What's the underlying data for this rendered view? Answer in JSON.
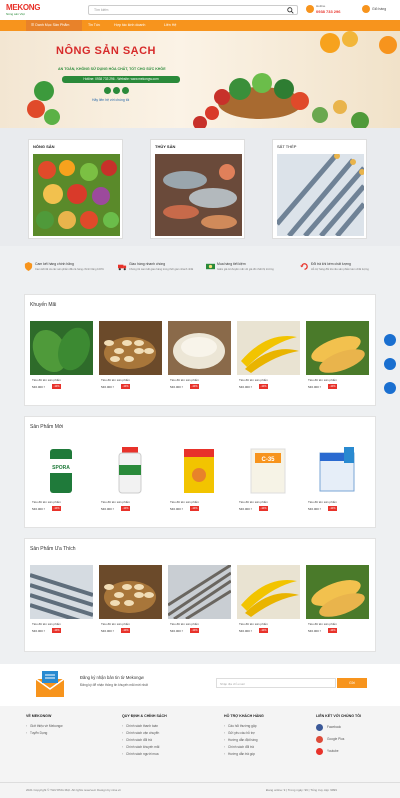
{
  "header": {
    "logo_text": "MEKONG",
    "logo_sub": "Nông sản Việt",
    "search_placeholder": "Tìm kiếm",
    "hotline_label": "Hotline",
    "hotline_number": "0938 733 296",
    "cart_label": "Giỏ hàng"
  },
  "nav": {
    "category_label": "☰ Danh Mục Sản Phẩm",
    "items": [
      "Tin Tức",
      "Hợp tác kinh doanh",
      "Liên Hệ"
    ]
  },
  "banner": {
    "title": "NÔNG SẢN SẠCH",
    "subtitle": "AN TOÀN, KHÔNG SỬ DỤNG HÓA CHẤT, TỐT CHO SỨC KHỎE",
    "hotline_bar": "Hotline: 0938 733 296 - Website: www.mekongw.com",
    "contact": "Hãy liên hệ với chúng tôi"
  },
  "categories": [
    {
      "name": "NÔNG SẢN"
    },
    {
      "name": "THỦY SẢN"
    },
    {
      "name": "SẮT THÉP"
    }
  ],
  "features": [
    {
      "title": "Cam kết hàng chính hãng",
      "desc": "Cam kết tất cả các sản phẩm đều là hàng chính hãng 100%"
    },
    {
      "title": "Giao hàng nhanh chóng",
      "desc": "Chúng tôi cam kết giao hàng trong thời gian nhanh nhất"
    },
    {
      "title": "Mua hàng tiết kiệm",
      "desc": "Giảm giá & khuyến mãi với giá tốt nhất thị trường"
    },
    {
      "title": "Đổi trả khi kém chất lượng",
      "desc": "Hỗ trợ hàng đổi trả nếu sản phẩm kém chất lượng"
    }
  ],
  "sections": [
    {
      "title": "Khuyến Mãi",
      "products": [
        {
          "name": "Tiêu đề tên sản phẩm",
          "price": "546.000 ₫",
          "badge": "-10%",
          "icon": "cucumber"
        },
        {
          "name": "Tiêu đề tên sản phẩm",
          "price": "546.000 ₫",
          "badge": "-10%",
          "icon": "cashew"
        },
        {
          "name": "Tiêu đề tên sản phẩm",
          "price": "546.000 ₫",
          "badge": "-10%",
          "icon": "rice"
        },
        {
          "name": "Tiêu đề tên sản phẩm",
          "price": "546.000 ₫",
          "badge": "-10%",
          "icon": "banana"
        },
        {
          "name": "Tiêu đề tên sản phẩm",
          "price": "546.000 ₫",
          "badge": "-10%",
          "icon": "corn"
        }
      ]
    },
    {
      "title": "Sản Phẩm Mới",
      "products": [
        {
          "name": "Tiêu đề tên sản phẩm",
          "price": "546.000 ₫",
          "badge": "-10%",
          "icon": "spora-bottle"
        },
        {
          "name": "Tiêu đề tên sản phẩm",
          "price": "546.000 ₫",
          "badge": "-10%",
          "icon": "white-bottle"
        },
        {
          "name": "Tiêu đề tên sản phẩm",
          "price": "546.000 ₫",
          "badge": "-10%",
          "icon": "yellow-box"
        },
        {
          "name": "Tiêu đề tên sản phẩm",
          "price": "546.000 ₫",
          "badge": "-10%",
          "icon": "c35-bag"
        },
        {
          "name": "Tiêu đề tên sản phẩm",
          "price": "546.000 ₫",
          "badge": "-10%",
          "icon": "blue-box"
        }
      ]
    },
    {
      "title": "Sản Phẩm Ưa Thích",
      "products": [
        {
          "name": "Tiêu đề tên sản phẩm",
          "price": "546.000 ₫",
          "badge": "-10%",
          "icon": "steel-pipes"
        },
        {
          "name": "Tiêu đề tên sản phẩm",
          "price": "546.000 ₫",
          "badge": "-10%",
          "icon": "cashew"
        },
        {
          "name": "Tiêu đề tên sản phẩm",
          "price": "546.000 ₫",
          "badge": "-10%",
          "icon": "rebar"
        },
        {
          "name": "Tiêu đề tên sản phẩm",
          "price": "546.000 ₫",
          "badge": "-10%",
          "icon": "banana"
        },
        {
          "name": "Tiêu đề tên sản phẩm",
          "price": "546.000 ₫",
          "badge": "-10%",
          "icon": "corn"
        }
      ]
    }
  ],
  "newsletter": {
    "title": "Đăng ký nhận bản tin từ Mekongw",
    "desc": "Đăng ký để nhận thông tin khuyến mãi mới nhất",
    "placeholder": "Nhập địa chỉ email",
    "button": "Gửi"
  },
  "footer": {
    "about": {
      "heading": "VỀ MEKONGW",
      "links": [
        "Giới thiệu về Mekongw",
        "Tuyển Dụng"
      ]
    },
    "policy": {
      "heading": "QUY ĐỊNH & CHÍNH SÁCH",
      "links": [
        "Chính sách thanh toán",
        "Chính sách vận chuyển",
        "Chính sách đổi trả",
        "Chính sách khuyến mãi",
        "Chính sách người mua"
      ]
    },
    "support": {
      "heading": "HỖ TRỢ KHÁCH HÀNG",
      "links": [
        "Câu hỏi thường gặp",
        "Gửi yêu cầu hỗ trợ",
        "Hướng dẫn đặt hàng",
        "Chính sách đổi trả",
        "Hướng dẫn trả góp"
      ]
    },
    "connect": {
      "heading": "LIÊN KẾT VỚI CHÚNG TÔI",
      "links": [
        "Facebook",
        "Google Plus",
        "Youtube"
      ]
    },
    "copyright": "2021 Copyright © THƯƠNG MẠI. All rights reserved. Design by nina.vn",
    "stats": "Đang online: 9  |  Trong ngày: 99  |  Tổng truy cập: 9999"
  },
  "colors": {
    "accent": "#f7941d",
    "brand_red": "#e8322a",
    "green": "#2a8a3a"
  }
}
